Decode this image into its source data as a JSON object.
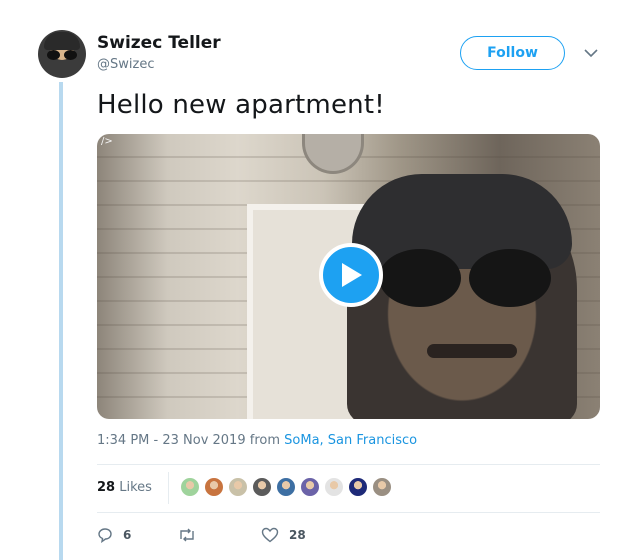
{
  "tweet": {
    "author_name": "Swizec Teller",
    "author_handle": "@Swizec",
    "follow_label": "Follow",
    "text": "Hello new apartment!",
    "media_tag": "/>",
    "time": "1:34 PM - 23 Nov 2019",
    "from_word": "from",
    "location": "SoMa, San Francisco",
    "likes_count": "28",
    "likes_label": "Likes",
    "replies_count": "6",
    "hearts_count": "28"
  },
  "likers": [
    {
      "icon": "liker-avatar",
      "color": "#9fd39c"
    },
    {
      "icon": "liker-avatar",
      "color": "#c8743f"
    },
    {
      "icon": "liker-avatar",
      "color": "#c9c1a8"
    },
    {
      "icon": "liker-avatar",
      "color": "#5b5b5b"
    },
    {
      "icon": "liker-avatar",
      "color": "#3d6fa3"
    },
    {
      "icon": "liker-avatar",
      "color": "#6b63a8"
    },
    {
      "icon": "liker-avatar",
      "color": "#e3e3e3"
    },
    {
      "icon": "liker-avatar",
      "color": "#1e2a78"
    },
    {
      "icon": "liker-avatar",
      "color": "#9a8f82"
    }
  ],
  "colors": {
    "accent": "#1da1f2",
    "link": "#1b95e0",
    "muted": "#657786",
    "thread": "#b8d9ef"
  }
}
